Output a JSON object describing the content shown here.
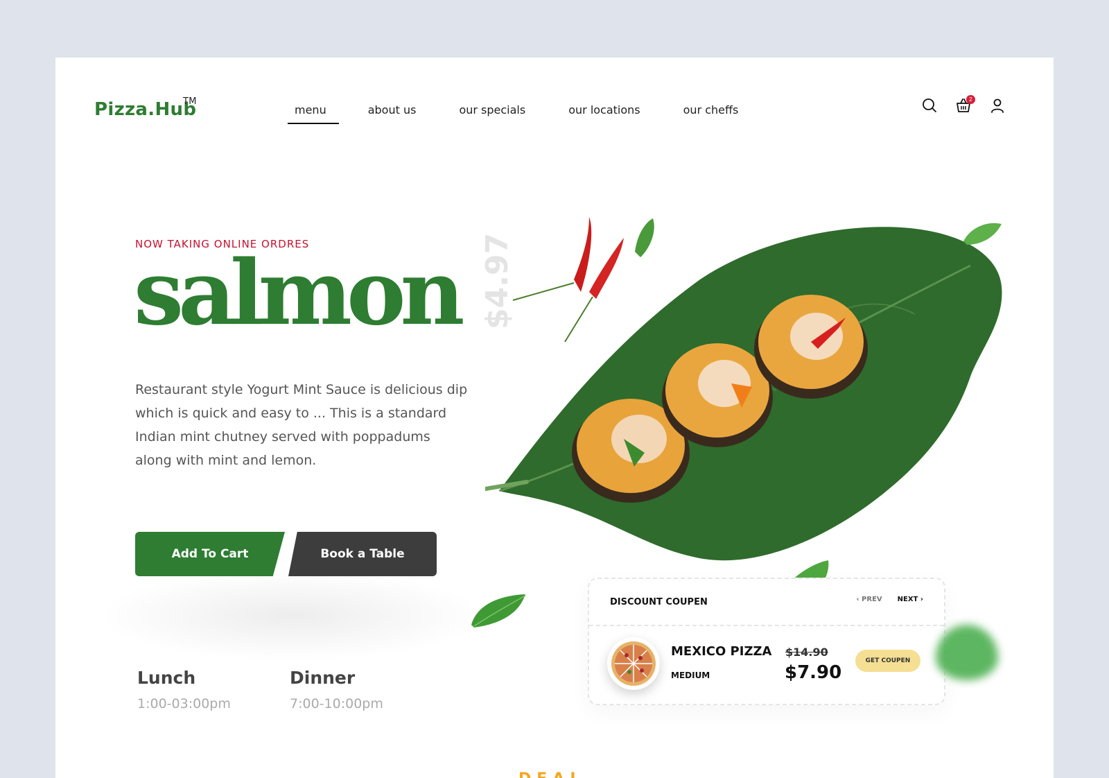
{
  "brand": {
    "name": "Pizza.Hub",
    "tm": "TM"
  },
  "nav": {
    "items": [
      {
        "label": "menu"
      },
      {
        "label": "about us"
      },
      {
        "label": "our specials"
      },
      {
        "label": "our locations"
      },
      {
        "label": "our cheffs"
      }
    ],
    "active_index": 0
  },
  "header_icons": {
    "search": "search-icon",
    "cart": "basket-icon",
    "cart_count": "2",
    "account": "user-icon"
  },
  "hero": {
    "eyebrow": "NOW TAKING ONLINE ORDRES",
    "title": "salmon",
    "price": "$4.97",
    "description": "Restaurant style Yogurt Mint Sauce is delicious dip which is quick and easy to ... This is a standard Indian mint chutney served with poppadums along with mint and lemon.",
    "add_to_cart": "Add To Cart",
    "book_table": "Book a Table"
  },
  "hours": [
    {
      "title": "Lunch",
      "time": "1:00-03:00pm"
    },
    {
      "title": "Dinner",
      "time": "7:00-10:00pm"
    }
  ],
  "coupon": {
    "heading": "DISCOUNT COUPEN",
    "prev": "PREV",
    "next": "NEXT",
    "item_name": "MEXICO PIZZA",
    "item_size": "MEDIUM",
    "old_price": "$14.90",
    "new_price": "$7.90",
    "button": "GET COUPEN"
  },
  "colors": {
    "brand_green": "#2e7d32",
    "accent_red": "#c8102e",
    "dark_button": "#3d3d3d",
    "coupon_yellow": "#f5df93"
  },
  "footer_peek": "DEAL"
}
